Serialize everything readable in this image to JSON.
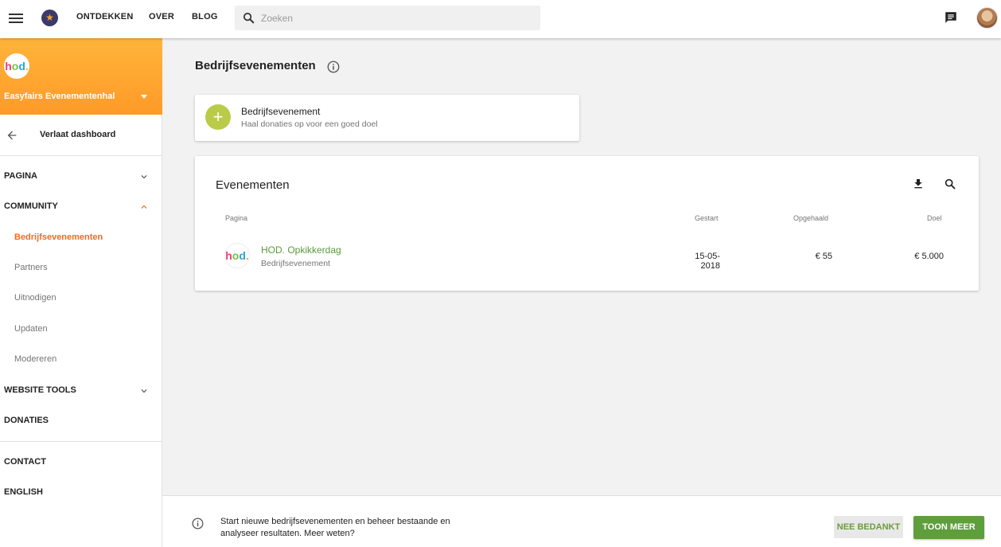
{
  "topbar": {
    "nav": [
      "ONTDEKKEN",
      "OVER",
      "BLOG"
    ],
    "search_placeholder": "Zoeken",
    "icons": {
      "menu": "menu-icon",
      "logo": "star-logo-icon",
      "search": "search-icon",
      "chat": "chat-icon"
    }
  },
  "sidebar": {
    "org_name": "Easyfairs Evenementenhal",
    "org_logo_text": "hod.",
    "back_label": "Verlaat dashboard",
    "sections": {
      "pagina": "PAGINA",
      "community": "COMMUNITY",
      "website_tools": "WEBSITE TOOLS",
      "donaties": "DONATIES",
      "contact": "CONTACT",
      "english": "ENGLISH"
    },
    "community_items": [
      "Bedrijfsevenementen",
      "Partners",
      "Uitnodigen",
      "Updaten",
      "Modereren"
    ],
    "active_item": "Bedrijfsevenementen"
  },
  "main": {
    "title": "Bedrijfsevenementen",
    "new_card": {
      "title": "Bedrijfsevenement",
      "subtitle": "Haal donaties op voor een goed doel"
    },
    "events": {
      "title": "Evenementen",
      "columns": [
        "Pagina",
        "Gestart",
        "Opgehaald",
        "Doel"
      ],
      "rows": [
        {
          "name": "HOD. Opkikkerdag",
          "type": "Bedrijfsevenement",
          "started": "15-05-2018",
          "raised": "€ 55",
          "goal": "€ 5.000"
        }
      ]
    }
  },
  "banner": {
    "text": "Start nieuwe bedrijfsevenementen en beheer bestaande en analyseer resultaten. Meer weten?",
    "dismiss_label": "NEE BEDANKT",
    "more_label": "TOON MEER"
  },
  "colors": {
    "accent_orange": "#f26b21",
    "header_orange": "#ffa830",
    "green": "#5f9e3c",
    "lime": "#bacb4a"
  }
}
